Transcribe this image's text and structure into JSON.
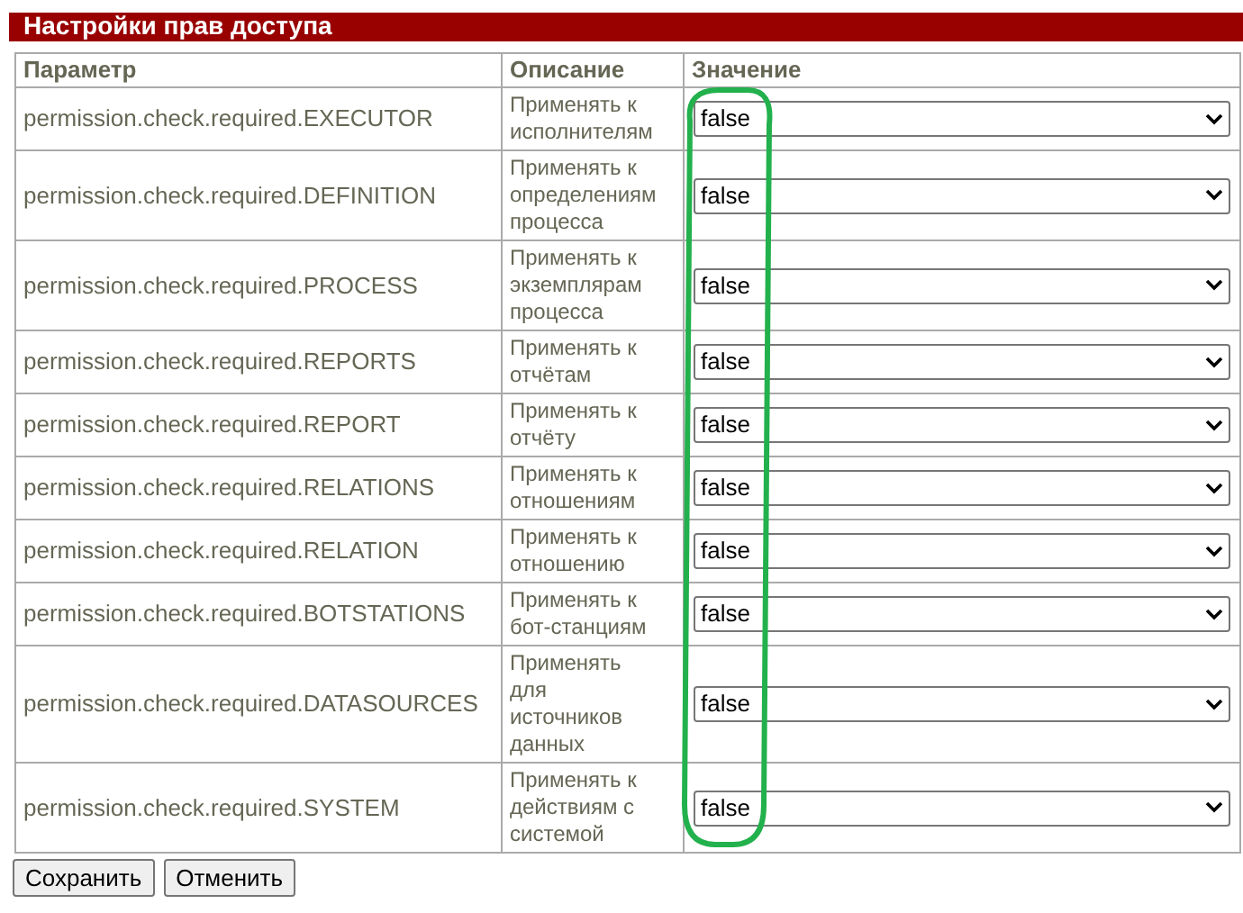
{
  "title": "Настройки прав доступа",
  "table": {
    "columns": [
      "Параметр",
      "Описание",
      "Значение"
    ],
    "rows": [
      {
        "parameter": "permission.check.required.EXECUTOR",
        "description": "Применять к\nисполнителям",
        "value": "false"
      },
      {
        "parameter": "permission.check.required.DEFINITION",
        "description": "Применять к\nопределениям\nпроцесса",
        "value": "false"
      },
      {
        "parameter": "permission.check.required.PROCESS",
        "description": "Применять к\nэкземплярам\nпроцесса",
        "value": "false"
      },
      {
        "parameter": "permission.check.required.REPORTS",
        "description": "Применять к\nотчётам",
        "value": "false"
      },
      {
        "parameter": "permission.check.required.REPORT",
        "description": "Применять к\nотчёту",
        "value": "false"
      },
      {
        "parameter": "permission.check.required.RELATIONS",
        "description": "Применять к\nотношениям",
        "value": "false"
      },
      {
        "parameter": "permission.check.required.RELATION",
        "description": "Применять к\nотношению",
        "value": "false"
      },
      {
        "parameter": "permission.check.required.BOTSTATIONS",
        "description": "Применять к\nбот-станциям",
        "value": "false"
      },
      {
        "parameter": "permission.check.required.DATASOURCES",
        "description": "Применять\nдля\nисточников\nданных",
        "value": "false"
      },
      {
        "parameter": "permission.check.required.SYSTEM",
        "description": "Применять к\nдействиям с\nсистемой",
        "value": "false"
      }
    ]
  },
  "buttons": [
    "Сохранить",
    "Отменить"
  ]
}
